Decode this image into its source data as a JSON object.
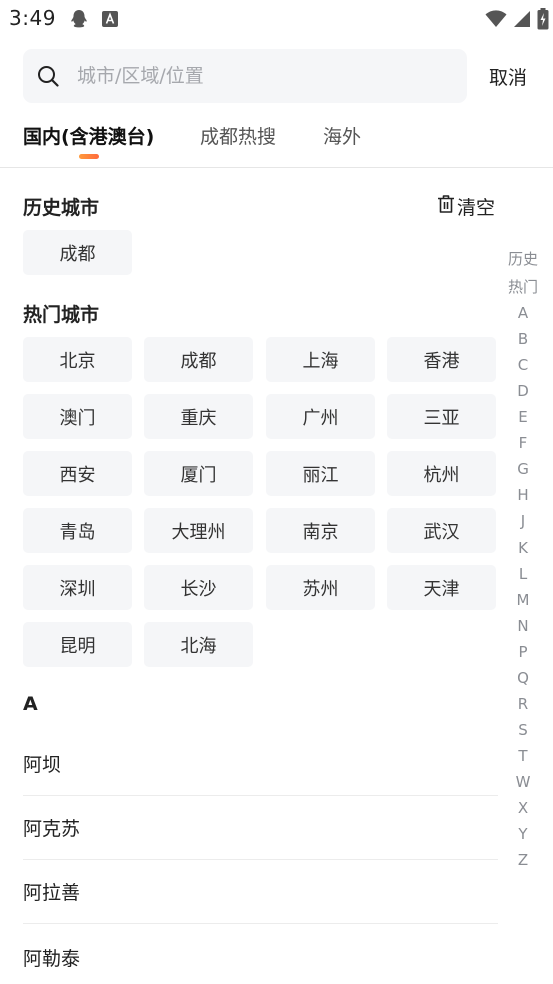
{
  "status_bar": {
    "time": "3:49"
  },
  "search": {
    "placeholder": "城市/区域/位置",
    "cancel_label": "取消"
  },
  "tabs": [
    {
      "label": "国内(含港澳台)"
    },
    {
      "label": "成都热搜"
    },
    {
      "label": "海外"
    }
  ],
  "history": {
    "title": "历史城市",
    "clear_label": "清空",
    "cities": [
      "成都"
    ]
  },
  "hot": {
    "title": "热门城市",
    "cities": [
      "北京",
      "成都",
      "上海",
      "香港",
      "澳门",
      "重庆",
      "广州",
      "三亚",
      "西安",
      "厦门",
      "丽江",
      "杭州",
      "青岛",
      "大理州",
      "南京",
      "武汉",
      "深圳",
      "长沙",
      "苏州",
      "天津",
      "昆明",
      "北海"
    ]
  },
  "city_list": {
    "letter": "A",
    "cities": [
      "阿坝",
      "阿克苏",
      "阿拉善",
      "阿勒泰"
    ]
  },
  "index_bar": [
    "历史",
    "热门",
    "A",
    "B",
    "C",
    "D",
    "E",
    "F",
    "G",
    "H",
    "J",
    "K",
    "L",
    "M",
    "N",
    "P",
    "Q",
    "R",
    "S",
    "T",
    "W",
    "X",
    "Y",
    "Z"
  ],
  "colors": {
    "accent": "#ff7a3d",
    "chip_bg": "#f5f6f8",
    "search_bg": "#f5f6f8"
  }
}
